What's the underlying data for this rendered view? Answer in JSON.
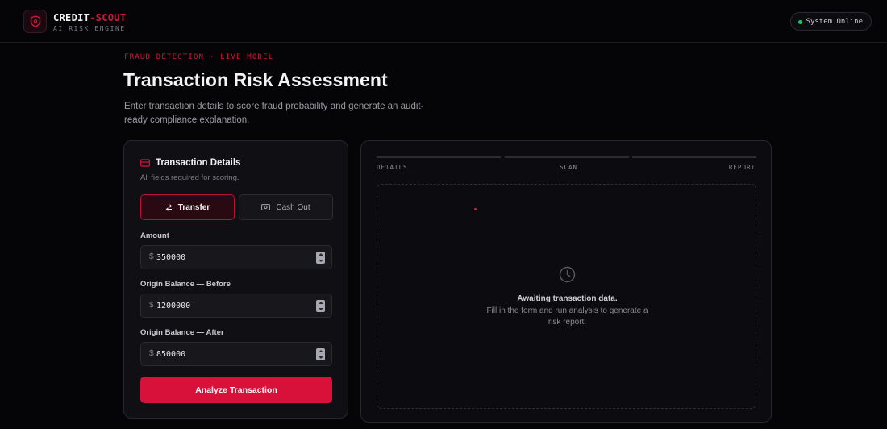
{
  "header": {
    "brand_main": "CREDIT",
    "brand_accent": "-SCOUT",
    "brand_sub": "AI RISK ENGINE",
    "status": "System Online"
  },
  "hero": {
    "eyebrow": "FRAUD DETECTION · LIVE MODEL",
    "title": "Transaction Risk Assessment",
    "description": "Enter transaction details to score fraud probability and generate an audit-ready compliance explanation."
  },
  "form": {
    "title": "Transaction Details",
    "subtitle": "All fields required for scoring.",
    "types": [
      {
        "label": "Transfer",
        "icon": "arrows-swap-icon",
        "selected": true
      },
      {
        "label": "Cash Out",
        "icon": "banknote-icon",
        "selected": false
      }
    ],
    "fields": [
      {
        "label": "Amount",
        "currency": "$",
        "value": "350000"
      },
      {
        "label": "Origin Balance — Before",
        "currency": "$",
        "value": "1200000"
      },
      {
        "label": "Origin Balance — After",
        "currency": "$",
        "value": "850000"
      }
    ],
    "submit_label": "Analyze Transaction"
  },
  "result": {
    "steps": [
      "DETAILS",
      "SCAN",
      "REPORT"
    ],
    "empty_title": "Awaiting transaction data.",
    "empty_desc": "Fill in the form and run analysis to generate a risk report."
  },
  "colors": {
    "accent": "#d8113a",
    "status_ok": "#22c55e",
    "background": "#050507"
  }
}
